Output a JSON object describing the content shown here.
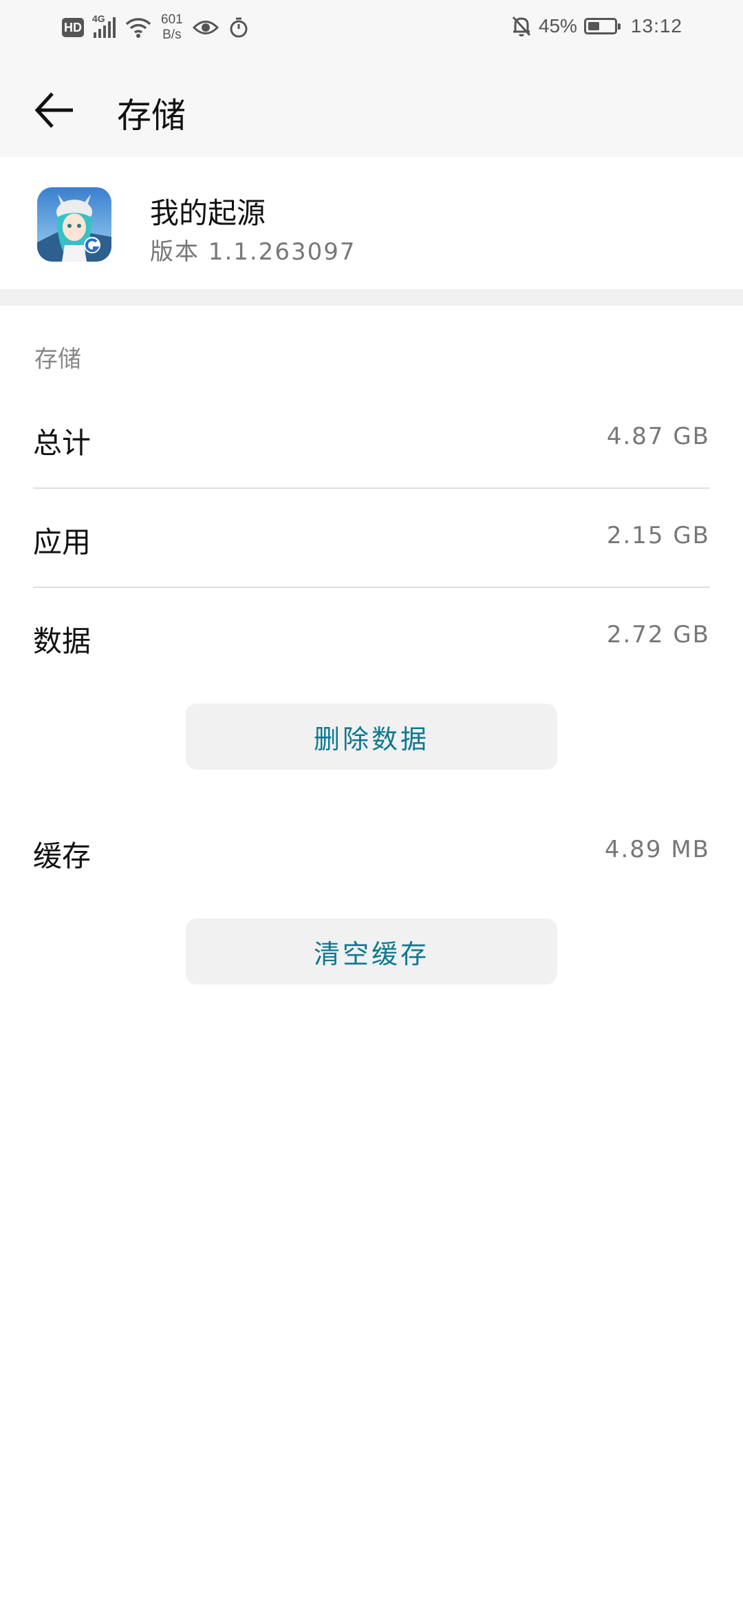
{
  "status_bar": {
    "hd": "HD",
    "network_type": "4G",
    "net_speed_value": "601",
    "net_speed_unit": "B/s",
    "battery_percent": "45%",
    "battery_level": 0.45,
    "time": "13:12",
    "icons": [
      "signal-icon",
      "wifi-icon",
      "eye-icon",
      "timer-icon",
      "bell-off-icon",
      "battery-icon"
    ]
  },
  "toolbar": {
    "title": "存储",
    "back_icon": "back-arrow-icon"
  },
  "app": {
    "name": "我的起源",
    "version": "版本 1.1.263097"
  },
  "storage": {
    "section_title": "存储",
    "total_label": "总计",
    "total_value": "4.87 GB",
    "app_label": "应用",
    "app_value": "2.15 GB",
    "data_label": "数据",
    "data_value": "2.72 GB",
    "delete_data_button": "删除数据",
    "cache_label": "缓存",
    "cache_value": "4.89 MB",
    "clear_cache_button": "清空缓存"
  },
  "colors": {
    "accent": "#0e7891",
    "bar_background": "#f7f7f7",
    "button_background": "#f1f1f1"
  }
}
